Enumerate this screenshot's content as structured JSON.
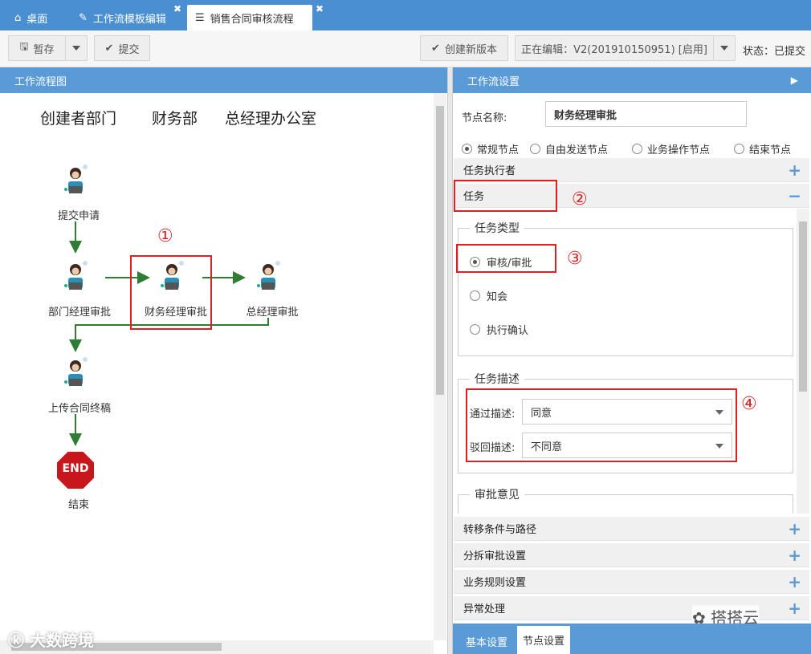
{
  "tabs": [
    {
      "label": "桌面",
      "icon": "home-icon"
    },
    {
      "label": "工作流模板编辑",
      "icon": "edit-icon"
    },
    {
      "label": "销售合同审核流程",
      "icon": "flow-icon"
    }
  ],
  "toolbar": {
    "save_label": "暂存",
    "submit_label": "提交",
    "new_version_label": "创建新版本",
    "editing_label": "正在编辑：V2(201910150951) [启用]",
    "status_label": "状态：已提交"
  },
  "left_panel": {
    "title": "工作流程图",
    "lanes": [
      "创建者部门",
      "财务部",
      "总经理办公室"
    ],
    "nodes": {
      "submit": "提交申请",
      "dept_manager": "部门经理审批",
      "finance_manager": "财务经理审批",
      "general_manager": "总经理审批",
      "upload": "上传合同终稿",
      "end_badge": "END",
      "end": "结束"
    },
    "annotation_1": "①"
  },
  "right_panel": {
    "title": "工作流设置",
    "node_name_label": "节点名称:",
    "node_name_value": "财务经理审批",
    "node_types": [
      "常规节点",
      "自由发送节点",
      "业务操作节点",
      "结束节点"
    ],
    "node_type_selected": 0,
    "sections": {
      "executor": "任务执行者",
      "task": "任务",
      "transfer": "转移条件与路径",
      "split": "分拆审批设置",
      "rules": "业务规则设置",
      "exception": "异常处理"
    },
    "task_type": {
      "legend": "任务类型",
      "options": [
        "审核/审批",
        "知会",
        "执行确认"
      ],
      "selected": 0
    },
    "task_desc": {
      "legend": "任务描述",
      "pass_label": "通过描述:",
      "pass_value": "同意",
      "reject_label": "驳回描述:",
      "reject_value": "不同意"
    },
    "opinion_legend": "审批意见",
    "bottom_tabs": [
      "基本设置",
      "节点设置"
    ],
    "annotations": [
      "②",
      "③",
      "④"
    ]
  },
  "watermarks": {
    "left": "大数跨境",
    "right": "搭搭云"
  },
  "colors": {
    "accent": "#5a9ad6",
    "tabbar": "#4a8fd1",
    "arrow": "#2e7d32",
    "annotation": "#e02020"
  }
}
